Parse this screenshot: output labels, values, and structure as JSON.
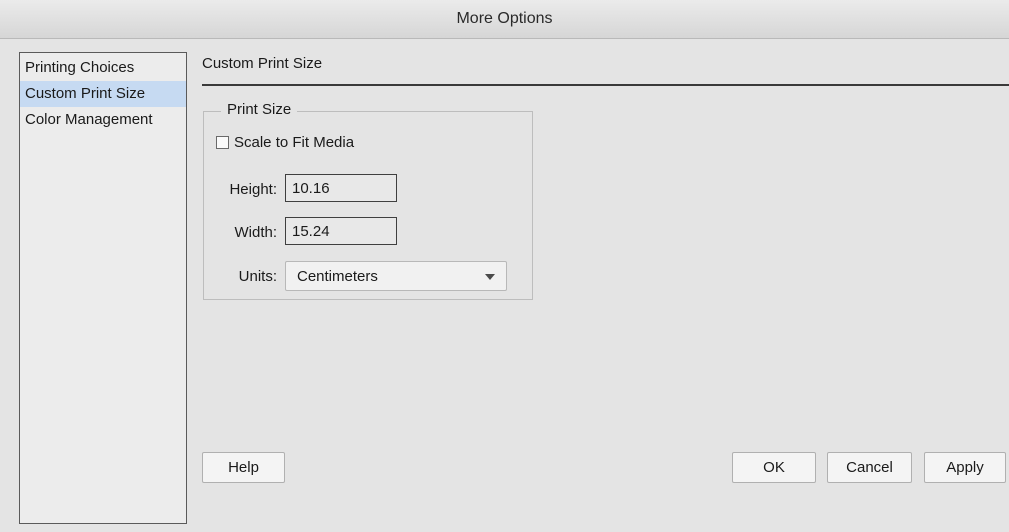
{
  "window": {
    "title": "More Options"
  },
  "sidebar": {
    "items": [
      {
        "label": "Printing Choices",
        "selected": false
      },
      {
        "label": "Custom Print Size",
        "selected": true
      },
      {
        "label": "Color Management",
        "selected": false
      }
    ]
  },
  "panel": {
    "title": "Custom Print Size",
    "group_title": "Print Size",
    "scale_to_fit": {
      "label": "Scale to Fit Media",
      "checked": false
    },
    "height": {
      "label": "Height:",
      "value": "10.16"
    },
    "width": {
      "label": "Width:",
      "value": "15.24"
    },
    "units": {
      "label": "Units:",
      "value": "Centimeters"
    }
  },
  "buttons": {
    "help": "Help",
    "ok": "OK",
    "cancel": "Cancel",
    "apply": "Apply"
  },
  "colors": {
    "selection": "#c6daf2",
    "background": "#e4e4e4"
  }
}
